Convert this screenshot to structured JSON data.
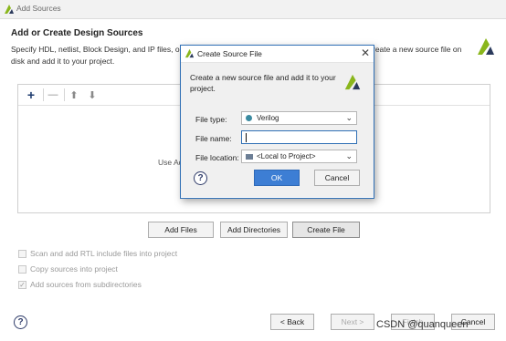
{
  "window": {
    "title": "Add Sources",
    "heading": "Add or Create Design Sources",
    "description_line1": "Specify HDL, netlist, Block Design, and IP files, or di",
    "description_right": "reate a new source file on",
    "description_line2": "disk and add it to your project."
  },
  "panel": {
    "toolbar": {
      "add": "+",
      "remove": "—",
      "up": "⬆",
      "down": "⬇"
    },
    "center_text": "Use Ad"
  },
  "buttons": {
    "add_files": "Add Files",
    "add_directories": "Add Directories",
    "create_file": "Create File",
    "back": "< Back",
    "next": "Next >",
    "finish": "Finish",
    "cancel": "Cancel",
    "help": "?"
  },
  "options": [
    {
      "label": "Scan and add RTL include files into project",
      "checked": false
    },
    {
      "label": "Copy sources into project",
      "checked": false
    },
    {
      "label": "Add sources from subdirectories",
      "checked": true
    }
  ],
  "dialog": {
    "title": "Create Source File",
    "close": "✕",
    "text": "Create a new source file and add it to your project.",
    "file_type_label": "File type:",
    "file_type_value": "Verilog",
    "file_name_label": "File name:",
    "file_name_value": "",
    "file_location_label": "File location:",
    "file_location_value": "<Local to Project>",
    "ok": "OK",
    "cancel": "Cancel",
    "help": "?"
  },
  "watermark": "CSDN @quanqueen",
  "colors": {
    "accent": "#3d7ed4",
    "logo_green": "#8ab61c",
    "logo_dark": "#2b3a5c"
  }
}
